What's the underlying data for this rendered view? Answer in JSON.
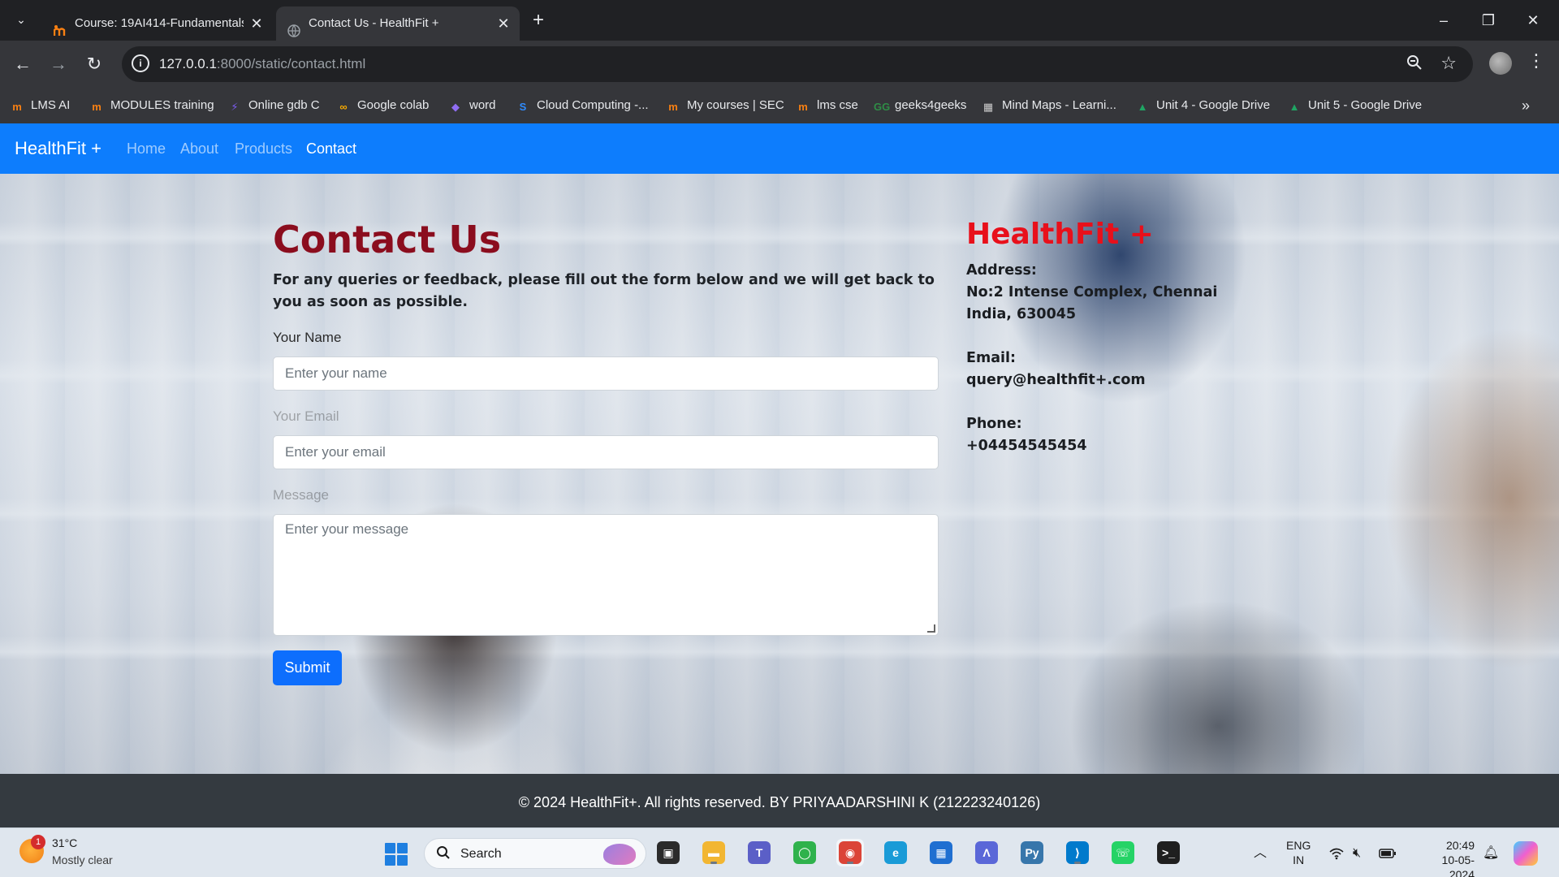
{
  "browser": {
    "tabs": [
      {
        "title": "Course: 19AI414-Fundamentals",
        "active": false
      },
      {
        "title": "Contact Us - HealthFit +",
        "active": true
      }
    ],
    "url_host": "127.0.0.1",
    "url_path": ":8000/static/contact.html",
    "bookmarks": [
      {
        "label": "LMS AI",
        "icon": "moodle-icon",
        "color": "#f98012"
      },
      {
        "label": "MODULES training",
        "icon": "moodle-icon",
        "color": "#f98012"
      },
      {
        "label": "Online gdb C",
        "icon": "bolt-icon",
        "color": "#7b5cf0"
      },
      {
        "label": "Google colab",
        "icon": "colab-icon",
        "color": "#f9ab00"
      },
      {
        "label": "word",
        "icon": "copilot-icon",
        "color": "#8f6df2"
      },
      {
        "label": "Cloud Computing -...",
        "icon": "cloud-icon",
        "color": "#2f8cff"
      },
      {
        "label": "My courses | SEC",
        "icon": "moodle-icon",
        "color": "#f98012"
      },
      {
        "label": "lms cse",
        "icon": "moodle-icon",
        "color": "#f98012"
      },
      {
        "label": "geeks4geeks",
        "icon": "gfg-icon",
        "color": "#2f8d46"
      },
      {
        "label": "Mind Maps - Learni...",
        "icon": "mindmap-icon",
        "color": "#cccccc"
      },
      {
        "label": "Unit 4 - Google Drive",
        "icon": "drive-icon",
        "color": "#1fa463"
      },
      {
        "label": "Unit 5 - Google Drive",
        "icon": "drive-icon",
        "color": "#1fa463"
      }
    ]
  },
  "site": {
    "brand": "HealthFit +",
    "nav": [
      {
        "label": "Home",
        "active": false
      },
      {
        "label": "About",
        "active": false
      },
      {
        "label": "Products",
        "active": false
      },
      {
        "label": "Contact",
        "active": true
      }
    ],
    "heading": "Contact Us",
    "lead": "For any queries or feedback, please fill out the form below and we will get back to you as soon as possible.",
    "form": {
      "name_label": "Your Name",
      "name_placeholder": "Enter your name",
      "email_label": "Your Email",
      "email_placeholder": "Enter your email",
      "message_label": "Message",
      "message_placeholder": "Enter your message",
      "submit_label": "Submit"
    },
    "sidebar": {
      "title": "HealthFit +",
      "address_label": "Address:",
      "address_line1": "No:2 Intense Complex, Chennai",
      "address_line2": "India, 630045",
      "email_label": "Email:",
      "email_value": "query@healthfit+.com",
      "phone_label": "Phone:",
      "phone_value": "+04454545454"
    },
    "footer": "© 2024 HealthFit+. All rights reserved. BY PRIYAADARSHINI K (212223240126)"
  },
  "colors": {
    "navbar": "#0d7dfd",
    "heading": "#8b0d1e",
    "sidebar_title": "#e8101b",
    "submit": "#0d6efd",
    "footer": "#343a40"
  },
  "taskbar": {
    "weather_temp": "31°C",
    "weather_desc": "Mostly clear",
    "weather_badge": "1",
    "search_label": "Search",
    "lang_line1": "ENG",
    "lang_line2": "IN",
    "time": "20:49",
    "date": "10-05-2024",
    "apps": [
      "task-view-icon",
      "file-explorer-icon",
      "teams-icon",
      "app-ring-icon",
      "chrome-icon",
      "edge-icon",
      "store-icon",
      "launcher-icon",
      "python-icon",
      "vscode-icon",
      "whatsapp-icon",
      "terminal-icon"
    ]
  }
}
